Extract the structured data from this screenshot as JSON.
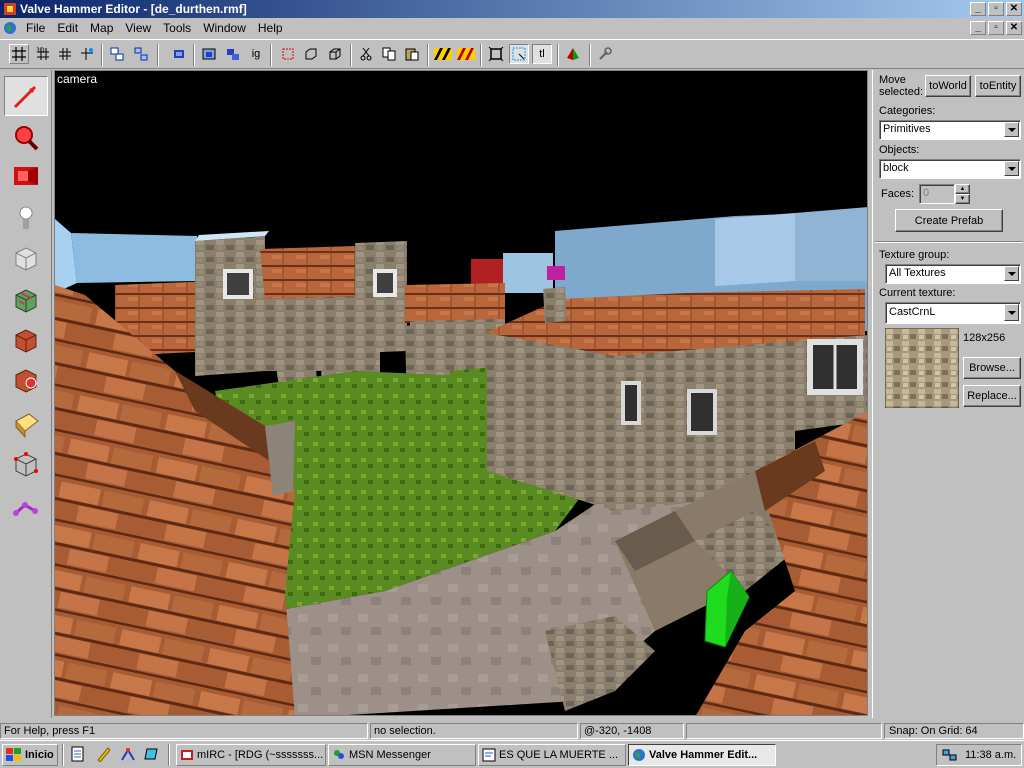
{
  "window": {
    "title": "Valve Hammer Editor - [de_durthen.rmf]",
    "caption_buttons": [
      "_",
      "▫",
      "✕"
    ]
  },
  "menu": {
    "items": [
      "File",
      "Edit",
      "Map",
      "View",
      "Tools",
      "Window",
      "Help"
    ],
    "mdi_buttons": [
      "_",
      "▫",
      "✕"
    ]
  },
  "toolbar": {
    "buttons": [
      "grid-icon",
      "grid-3d-icon",
      "grid-small-icon",
      "grid-large-icon",
      "group-icon",
      "ungroup-icon",
      "carve-icon",
      "texture-lock-icon",
      "hide-icon",
      "show-icon",
      "ignore-groups-icon",
      "select-icon",
      "cordon-icon",
      "cube-icon",
      "cut-icon",
      "copy-icon",
      "paste-icon",
      "hazard-icon",
      "hazard-red-icon",
      "3d-box-icon",
      "3d-view-icon",
      "tl-icon",
      "run-icon",
      "wrench-icon"
    ],
    "ig_label": "ig",
    "tl_label": "tl"
  },
  "tools": [
    "selection-tool-icon",
    "magnify-tool-icon",
    "camera-tool-icon",
    "entity-tool-icon",
    "block-tool-icon",
    "texture-tool-icon",
    "apply-texture-icon",
    "decal-tool-icon",
    "overlay-tool-icon",
    "clip-tool-icon",
    "vertex-tool-icon",
    "path-tool-icon"
  ],
  "viewport": {
    "label": "camera"
  },
  "rightpanel": {
    "move_selected": "Move selected:",
    "to_world": "toWorld",
    "to_entity": "toEntity",
    "categories_label": "Categories:",
    "categories_value": "Primitives",
    "objects_label": "Objects:",
    "objects_value": "block",
    "faces_label": "Faces:",
    "faces_value": "0",
    "create_prefab": "Create Prefab",
    "texture_group_label": "Texture group:",
    "texture_group_value": "All Textures",
    "current_texture_label": "Current texture:",
    "current_texture_value": "CastCrnL",
    "texture_size": "128x256",
    "browse": "Browse...",
    "replace": "Replace..."
  },
  "status": {
    "help": "For Help, press F1",
    "selection": "no selection.",
    "coords": "@-320, -1408",
    "snap": "Snap: On Grid: 64"
  },
  "taskbar": {
    "start": "Inicio",
    "tasks": [
      "mIRC - [RDG (~sssssss...",
      "MSN Messenger",
      "ES QUE LA MUERTE ...",
      "Valve Hammer Edit..."
    ],
    "clock": "11:38 a.m."
  },
  "colors": {
    "title_start": "#0a246a",
    "title_end": "#a6caf0",
    "face": "#c0c0c0",
    "selection_green": "#1fdc1f"
  }
}
